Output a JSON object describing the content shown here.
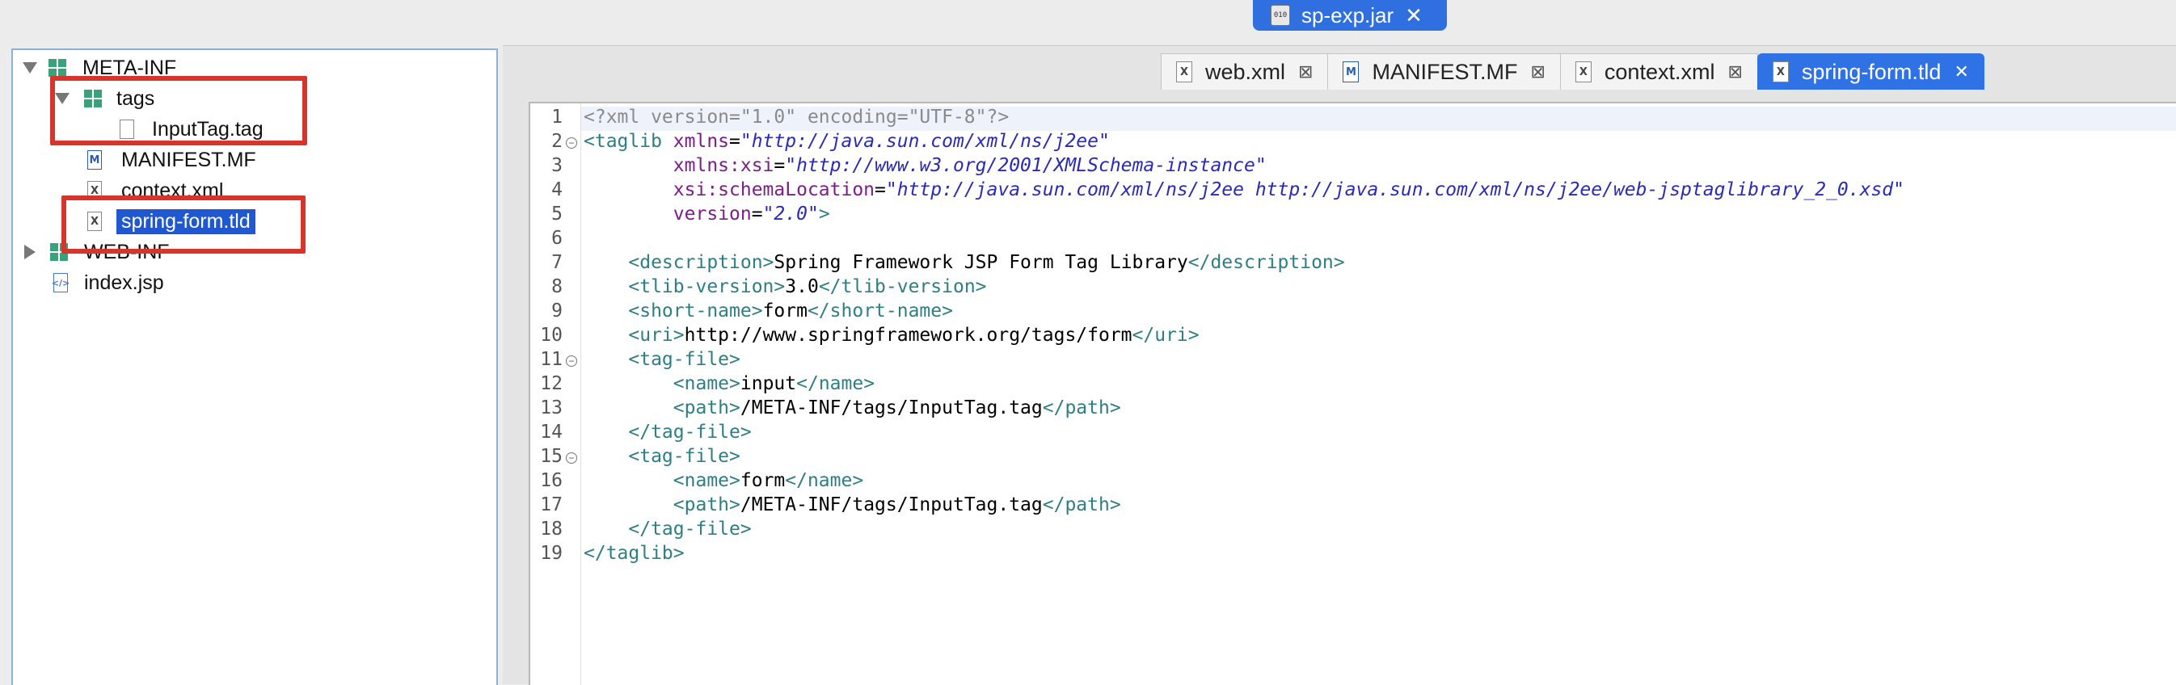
{
  "window": {
    "archive_tab": {
      "label": "sp-exp.jar",
      "icon": "jar-file-icon"
    }
  },
  "explorer": {
    "items": [
      {
        "label": "META-INF",
        "icon": "package-icon",
        "expanded": true
      },
      {
        "label": "tags",
        "icon": "package-icon",
        "expanded": true
      },
      {
        "label": "InputTag.tag",
        "icon": "file-icon"
      },
      {
        "label": "MANIFEST.MF",
        "icon": "manifest-file-icon"
      },
      {
        "label": "context.xml",
        "icon": "xml-file-icon"
      },
      {
        "label": "spring-form.tld",
        "icon": "xml-file-icon",
        "selected": true
      },
      {
        "label": "WEB-INF",
        "icon": "package-icon",
        "expanded": false
      },
      {
        "label": "index.jsp",
        "icon": "jsp-file-icon"
      }
    ]
  },
  "editor": {
    "tabs": [
      {
        "label": "web.xml",
        "icon": "xml-file-icon",
        "active": false
      },
      {
        "label": "MANIFEST.MF",
        "icon": "manifest-file-icon",
        "active": false
      },
      {
        "label": "context.xml",
        "icon": "xml-file-icon",
        "active": false
      },
      {
        "label": "spring-form.tld",
        "icon": "xml-file-icon",
        "active": true
      }
    ],
    "lines": [
      {
        "n": "1",
        "fold": false,
        "indent": "",
        "parts": [
          [
            "pi",
            "<?xml version=\"1.0\" encoding=\"UTF-8\"?>"
          ]
        ]
      },
      {
        "n": "2",
        "fold": true,
        "indent": "",
        "parts": [
          [
            "tag",
            "<taglib "
          ],
          [
            "attr",
            "xmlns"
          ],
          [
            "txt",
            "="
          ],
          [
            "val",
            "\"http://java.sun.com/xml/ns/j2ee\""
          ]
        ]
      },
      {
        "n": "3",
        "fold": false,
        "indent": "        ",
        "parts": [
          [
            "attr",
            "xmlns:xsi"
          ],
          [
            "txt",
            "="
          ],
          [
            "val",
            "\"http://www.w3.org/2001/XMLSchema-instance\""
          ]
        ]
      },
      {
        "n": "4",
        "fold": false,
        "indent": "        ",
        "parts": [
          [
            "attr",
            "xsi:schemaLocation"
          ],
          [
            "txt",
            "="
          ],
          [
            "val",
            "\"http://java.sun.com/xml/ns/j2ee http://java.sun.com/xml/ns/j2ee/web-jsptaglibrary_2_0.xsd\""
          ]
        ]
      },
      {
        "n": "5",
        "fold": false,
        "indent": "        ",
        "parts": [
          [
            "attr",
            "version"
          ],
          [
            "txt",
            "="
          ],
          [
            "val",
            "\"2.0\""
          ],
          [
            "tag",
            ">"
          ]
        ]
      },
      {
        "n": "6",
        "fold": false,
        "indent": "",
        "parts": []
      },
      {
        "n": "7",
        "fold": false,
        "indent": "    ",
        "parts": [
          [
            "tag",
            "<description>"
          ],
          [
            "txt",
            "Spring Framework JSP Form Tag Library"
          ],
          [
            "tag",
            "</description>"
          ]
        ]
      },
      {
        "n": "8",
        "fold": false,
        "indent": "    ",
        "parts": [
          [
            "tag",
            "<tlib-version>"
          ],
          [
            "txt",
            "3.0"
          ],
          [
            "tag",
            "</tlib-version>"
          ]
        ]
      },
      {
        "n": "9",
        "fold": false,
        "indent": "    ",
        "parts": [
          [
            "tag",
            "<short-name>"
          ],
          [
            "txt",
            "form"
          ],
          [
            "tag",
            "</short-name>"
          ]
        ]
      },
      {
        "n": "10",
        "fold": false,
        "indent": "    ",
        "parts": [
          [
            "tag",
            "<uri>"
          ],
          [
            "txt",
            "http://www.springframework.org/tags/form"
          ],
          [
            "tag",
            "</uri>"
          ]
        ]
      },
      {
        "n": "11",
        "fold": true,
        "indent": "    ",
        "parts": [
          [
            "tag",
            "<tag-file>"
          ]
        ]
      },
      {
        "n": "12",
        "fold": false,
        "indent": "        ",
        "parts": [
          [
            "tag",
            "<name>"
          ],
          [
            "txt",
            "input"
          ],
          [
            "tag",
            "</name>"
          ]
        ]
      },
      {
        "n": "13",
        "fold": false,
        "indent": "        ",
        "parts": [
          [
            "tag",
            "<path>"
          ],
          [
            "txt",
            "/META-INF/tags/InputTag.tag"
          ],
          [
            "tag",
            "</path>"
          ]
        ]
      },
      {
        "n": "14",
        "fold": false,
        "indent": "    ",
        "parts": [
          [
            "tag",
            "</tag-file>"
          ]
        ]
      },
      {
        "n": "15",
        "fold": true,
        "indent": "    ",
        "parts": [
          [
            "tag",
            "<tag-file>"
          ]
        ]
      },
      {
        "n": "16",
        "fold": false,
        "indent": "        ",
        "parts": [
          [
            "tag",
            "<name>"
          ],
          [
            "txt",
            "form"
          ],
          [
            "tag",
            "</name>"
          ]
        ]
      },
      {
        "n": "17",
        "fold": false,
        "indent": "        ",
        "parts": [
          [
            "tag",
            "<path>"
          ],
          [
            "txt",
            "/META-INF/tags/InputTag.tag"
          ],
          [
            "tag",
            "</path>"
          ]
        ]
      },
      {
        "n": "18",
        "fold": false,
        "indent": "    ",
        "parts": [
          [
            "tag",
            "</tag-file>"
          ]
        ]
      },
      {
        "n": "19",
        "fold": false,
        "indent": "",
        "parts": [
          [
            "tag",
            "</taglib>"
          ]
        ]
      }
    ]
  },
  "colors": {
    "selection": "#1f58d0",
    "active_tab": "#2f72e6",
    "highlight_box": "#d6352c",
    "xml_tag": "#2e7e84",
    "xml_attr": "#7b1f86",
    "xml_value": "#2a2ab8"
  }
}
